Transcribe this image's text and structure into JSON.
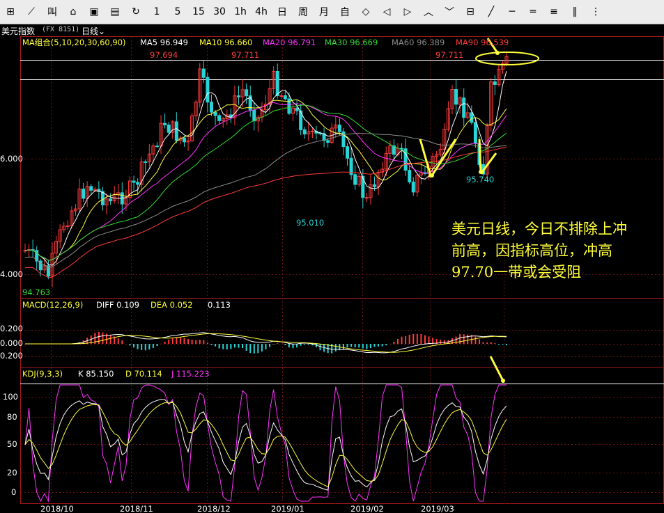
{
  "toolbar": {
    "items": [
      {
        "label": "⊞",
        "icon": "layout-icon"
      },
      {
        "label": "⟋",
        "icon": "draw-icon"
      },
      {
        "label": "叫",
        "icon": "chip-icon"
      },
      {
        "label": "⌂",
        "icon": "home-icon"
      },
      {
        "label": "▣",
        "icon": "grid-icon"
      },
      {
        "label": "▤",
        "icon": "save-icon"
      },
      {
        "label": "↻",
        "icon": "refresh-icon"
      },
      {
        "label": "1"
      },
      {
        "label": "5"
      },
      {
        "label": "15"
      },
      {
        "label": "30"
      },
      {
        "label": "1h"
      },
      {
        "label": "4h"
      },
      {
        "label": "日"
      },
      {
        "label": "周"
      },
      {
        "label": "月"
      },
      {
        "label": "自"
      },
      {
        "label": "◇",
        "icon": "diamond-icon"
      },
      {
        "label": "◁",
        "icon": "arrow-left-icon"
      },
      {
        "label": "▷",
        "icon": "arrow-right-icon"
      },
      {
        "label": "︿",
        "icon": "zoom-in-icon"
      },
      {
        "label": "﹀",
        "icon": "zoom-out-icon"
      },
      {
        "label": "⊟",
        "icon": "table-icon"
      },
      {
        "label": "╱",
        "icon": "line-icon"
      },
      {
        "label": "─",
        "icon": "hline-icon"
      },
      {
        "label": "═",
        "icon": "double-line-icon"
      },
      {
        "label": "≡",
        "icon": "menu-icon"
      },
      {
        "label": "‖",
        "icon": "parallel-icon"
      },
      {
        "label": "⋮",
        "icon": "vertical-icon"
      }
    ]
  },
  "title": {
    "name": "美元指数",
    "symbol": "(FX 8151)",
    "period": "日线"
  },
  "ma_legend": {
    "group": "MA组合(5,10,20,30,60,90)",
    "ma5": "MA5 96.949",
    "ma10": "MA10 96.660",
    "ma20": "MA20 96.791",
    "ma30": "MA30 96.669",
    "ma60": "MA60 96.389",
    "ma90": "MA90 96.539"
  },
  "price_axis": {
    "mid": "6.000",
    "low": "4.000"
  },
  "price_labels": {
    "h1": "97.694",
    "h2": "97.711",
    "h3": "97.711",
    "l1": "95.010",
    "l2": "95.740",
    "bottom": "94.763"
  },
  "macd_legend": {
    "name": "MACD(12,26,9)",
    "diff": "DIFF 0.109",
    "dea": "DEA 0.052",
    "macd": "0.113"
  },
  "macd_axis": [
    "0.200",
    "0.000",
    "0.200"
  ],
  "kdj_legend": {
    "name": "KDJ(9,3,3)",
    "k": "K 85.150",
    "d": "D 70.114",
    "j": "J 115.223"
  },
  "kdj_axis": [
    "100",
    "80",
    "50",
    "20",
    "0"
  ],
  "date_axis": [
    "2018/10",
    "2018/11",
    "2018/12",
    "2019/01",
    "2019/02",
    "2019/03"
  ],
  "annotation": [
    "美元日线，今日不排除上冲",
    "前高，因指标高位，冲高",
    "97.70一带或会受阻"
  ],
  "colors": {
    "up": "#ff3b3b",
    "down": "#27d4d6",
    "ma5": "#ffffff",
    "ma10": "#ffff3b",
    "ma20": "#ff33ff",
    "ma30": "#33dd33",
    "ma60": "#8b8b8b",
    "ma90": "#ff3b3b",
    "grid": "#7a1a1a",
    "ann": "#ffff3b"
  }
}
